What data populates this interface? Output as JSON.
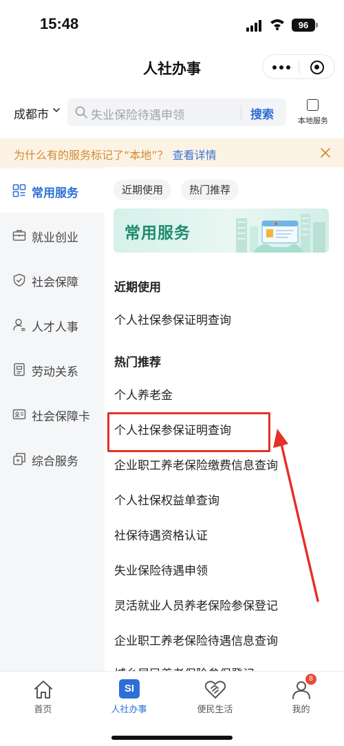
{
  "status_bar": {
    "time": "15:48",
    "battery": "96"
  },
  "navbar": {
    "title": "人社办事"
  },
  "search": {
    "city": "成都市",
    "placeholder": "失业保险待遇申领",
    "button": "搜索",
    "local_service_label": "本地服务"
  },
  "banner": {
    "text": "为什么有的服务标记了“本地”？",
    "link": "查看详情"
  },
  "sidebar": {
    "items": [
      {
        "label": "常用服务",
        "icon": "grid-icon",
        "active": true
      },
      {
        "label": "就业创业",
        "icon": "briefcase-icon"
      },
      {
        "label": "社会保障",
        "icon": "shield-icon"
      },
      {
        "label": "人才人事",
        "icon": "person-icon"
      },
      {
        "label": "劳动关系",
        "icon": "document-icon"
      },
      {
        "label": "社会保障卡",
        "icon": "id-card-icon"
      },
      {
        "label": "综合服务",
        "icon": "stack-icon"
      }
    ]
  },
  "content": {
    "chips": [
      "近期使用",
      "热门推荐"
    ],
    "hero_title": "常用服务",
    "recent_heading": "近期使用",
    "recent_items": [
      "个人社保参保证明查询"
    ],
    "hot_heading": "热门推荐",
    "hot_items": [
      "个人养老金",
      "个人社保参保证明查询",
      "企业职工养老保险缴费信息查询",
      "个人社保权益单查询",
      "社保待遇资格认证",
      "失业保险待遇申领",
      "灵活就业人员养老保险参保登记",
      "企业职工养老保险待遇信息查询",
      "城乡居民养老保险参保登记"
    ]
  },
  "tabbar": {
    "tabs": [
      {
        "label": "首页",
        "icon": "home-icon"
      },
      {
        "label": "人社办事",
        "icon": "si-icon",
        "badge_text": "SI",
        "active": true
      },
      {
        "label": "便民生活",
        "icon": "handshake-icon"
      },
      {
        "label": "我的",
        "icon": "user-icon",
        "notification": "8"
      }
    ]
  },
  "colors": {
    "accent": "#2d6fd6",
    "banner_bg": "#fdf3e4",
    "banner_text": "#d08b34",
    "hero_text": "#1e8c6b",
    "annotation": "#e53029"
  }
}
